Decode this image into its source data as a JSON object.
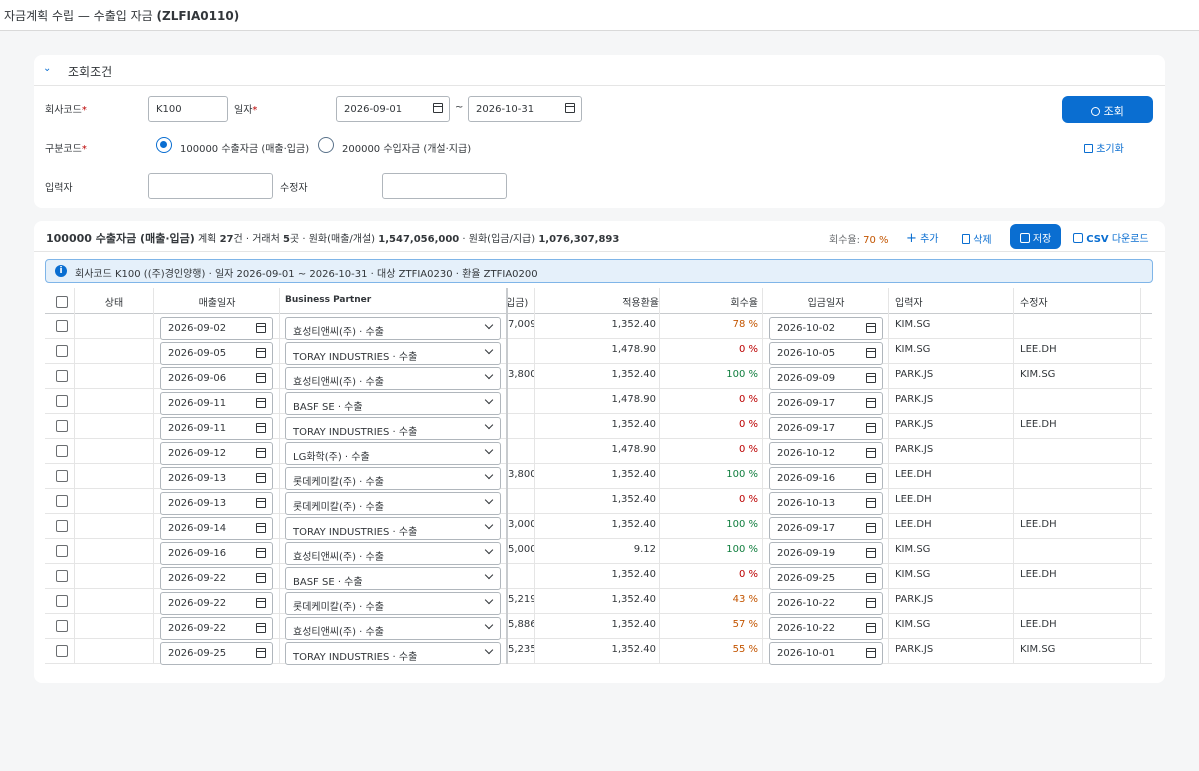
{
  "title_prefix": "자금계획 수립 — 수출입 자금 ",
  "title_code": "(ZLFIA0110)",
  "filter": {
    "section_title": "조회조건",
    "company_label": "회사코드",
    "company_value": "K100",
    "date_label": "일자",
    "date_from": "2026-09-01",
    "date_sep": "~",
    "date_to": "2026-10-31",
    "type_label": "구분코드",
    "radio1": "100000 수출자금 (매출·입금)",
    "radio2": "200000 수입자금 (개설·지급)",
    "entered_label": "입력자",
    "modified_label": "수정자",
    "search_button": "조회",
    "reset_link": "초기화"
  },
  "summary": {
    "title": "100000 수출자금 (매출·입금)",
    "plans_pre": "계획 ",
    "plans": "27",
    "plans_suf": "건 · 거래처 ",
    "partners": "5",
    "partners_suf": "곳 · 원화(매출/개설) ",
    "sales": "1,547,056,000",
    "mid": " · 원화(입금/지급) ",
    "receipts": "1,076,307,893"
  },
  "toolbar": {
    "rate_label": "회수율: ",
    "rate_value": "70 %",
    "add": "추가",
    "delete": "삭제",
    "save": "저장",
    "csv_bold": "CSV",
    "csv": " 다운로드"
  },
  "info": "회사코드 K100 ((주)경인양행) · 일자 2026-09-01 ~ 2026-10-31 · 대상 ZTFIA0230 · 환율 ZTFIA0200",
  "columns": {
    "status": "상태",
    "sale_date": "매출일자",
    "bp": "Business Partner",
    "krw_in": "입금)",
    "rate": "적용환율",
    "recovery": "회수율",
    "in_date": "입금일자",
    "entered": "입력자",
    "modified": "수정자"
  },
  "colors": {
    "accent": "#0a6ed1",
    "good": "#107e3e",
    "bad": "#bb0000",
    "partial": "#c35500"
  },
  "rows": [
    {
      "sale_date": "2026-09-02",
      "bp": "효성티앤씨(주) · 수출",
      "amt": "7,009",
      "rate": "1,352.40",
      "rec": "78 %",
      "in_date": "2026-10-02",
      "entered": "KIM.SG",
      "modified": ""
    },
    {
      "sale_date": "2026-09-05",
      "bp": "TORAY INDUSTRIES · 수출",
      "amt": "",
      "rate": "1,478.90",
      "rec": "0 %",
      "in_date": "2026-10-05",
      "entered": "KIM.SG",
      "modified": "LEE.DH"
    },
    {
      "sale_date": "2026-09-06",
      "bp": "효성티앤씨(주) · 수출",
      "amt": "3,800",
      "rate": "1,352.40",
      "rec": "100 %",
      "in_date": "2026-09-09",
      "entered": "PARK.JS",
      "modified": "KIM.SG"
    },
    {
      "sale_date": "2026-09-11",
      "bp": "BASF SE · 수출",
      "amt": "",
      "rate": "1,478.90",
      "rec": "0 %",
      "in_date": "2026-09-17",
      "entered": "PARK.JS",
      "modified": ""
    },
    {
      "sale_date": "2026-09-11",
      "bp": "TORAY INDUSTRIES · 수출",
      "amt": "",
      "rate": "1,352.40",
      "rec": "0 %",
      "in_date": "2026-09-17",
      "entered": "PARK.JS",
      "modified": "LEE.DH"
    },
    {
      "sale_date": "2026-09-12",
      "bp": "LG화학(주) · 수출",
      "amt": "",
      "rate": "1,478.90",
      "rec": "0 %",
      "in_date": "2026-10-12",
      "entered": "PARK.JS",
      "modified": ""
    },
    {
      "sale_date": "2026-09-13",
      "bp": "롯데케미칼(주) · 수출",
      "amt": "3,800",
      "rate": "1,352.40",
      "rec": "100 %",
      "in_date": "2026-09-16",
      "entered": "LEE.DH",
      "modified": ""
    },
    {
      "sale_date": "2026-09-13",
      "bp": "롯데케미칼(주) · 수출",
      "amt": "",
      "rate": "1,352.40",
      "rec": "0 %",
      "in_date": "2026-10-13",
      "entered": "LEE.DH",
      "modified": ""
    },
    {
      "sale_date": "2026-09-14",
      "bp": "TORAY INDUSTRIES · 수출",
      "amt": "3,000",
      "rate": "1,352.40",
      "rec": "100 %",
      "in_date": "2026-09-17",
      "entered": "LEE.DH",
      "modified": "LEE.DH"
    },
    {
      "sale_date": "2026-09-16",
      "bp": "효성티앤씨(주) · 수출",
      "amt": "5,000",
      "rate": "9.12",
      "rec": "100 %",
      "in_date": "2026-09-19",
      "entered": "KIM.SG",
      "modified": ""
    },
    {
      "sale_date": "2026-09-22",
      "bp": "BASF SE · 수출",
      "amt": "",
      "rate": "1,352.40",
      "rec": "0 %",
      "in_date": "2026-09-25",
      "entered": "KIM.SG",
      "modified": "LEE.DH"
    },
    {
      "sale_date": "2026-09-22",
      "bp": "롯데케미칼(주) · 수출",
      "amt": "5,219",
      "rate": "1,352.40",
      "rec": "43 %",
      "in_date": "2026-10-22",
      "entered": "PARK.JS",
      "modified": ""
    },
    {
      "sale_date": "2026-09-22",
      "bp": "효성티앤씨(주) · 수출",
      "amt": "5,886",
      "rate": "1,352.40",
      "rec": "57 %",
      "in_date": "2026-10-22",
      "entered": "KIM.SG",
      "modified": "LEE.DH"
    },
    {
      "sale_date": "2026-09-25",
      "bp": "TORAY INDUSTRIES · 수출",
      "amt": "5,235",
      "rate": "1,352.40",
      "rec": "55 %",
      "in_date": "2026-10-01",
      "entered": "PARK.JS",
      "modified": "KIM.SG"
    }
  ]
}
